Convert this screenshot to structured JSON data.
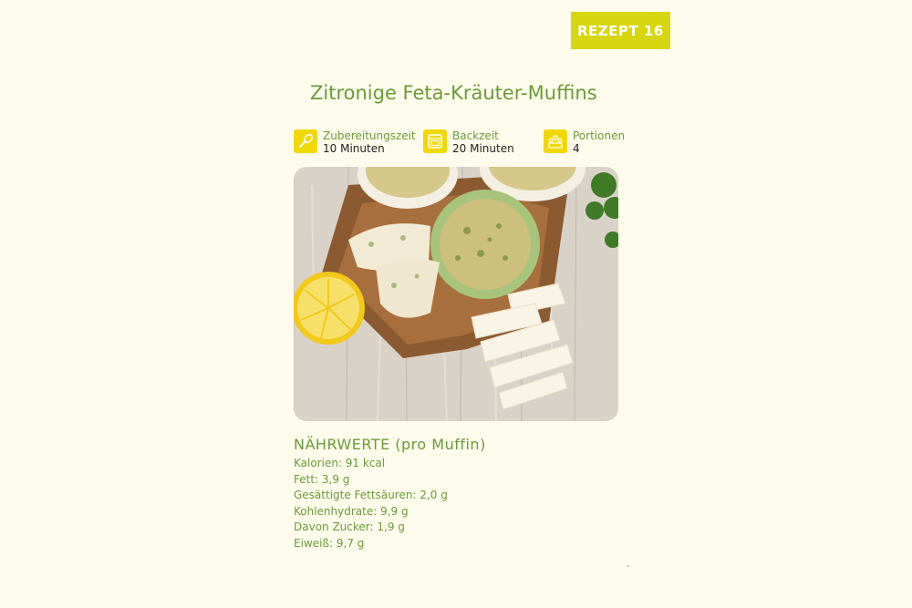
{
  "badge": "REZEPT 16",
  "title": "Zitronige Feta-Kräuter-Muffins",
  "meta": {
    "prep": {
      "label": "Zubereitungszeit",
      "value": "10 Minuten",
      "icon": "whisk-icon"
    },
    "bake": {
      "label": "Backzeit",
      "value": "20 Minuten",
      "icon": "oven-icon"
    },
    "portions": {
      "label": "Portionen",
      "value": "4",
      "icon": "people-icon"
    }
  },
  "nutrition": {
    "heading": "NÄHRWERTE (pro Muffin)",
    "items": [
      "Kalorien: 91 kcal",
      "Fett: 3,9 g",
      "Gesättigte Fettsäuren: 2,0 g",
      "Kohlenhydrate: 9,9 g",
      "Davon Zucker: 1,9 g",
      "Eiweiß: 9,7 g"
    ]
  },
  "colors": {
    "background": "#fdfbec",
    "badge": "#d6d60f",
    "accent_green": "#6a9b3a",
    "icon_yellow": "#f0d800"
  }
}
